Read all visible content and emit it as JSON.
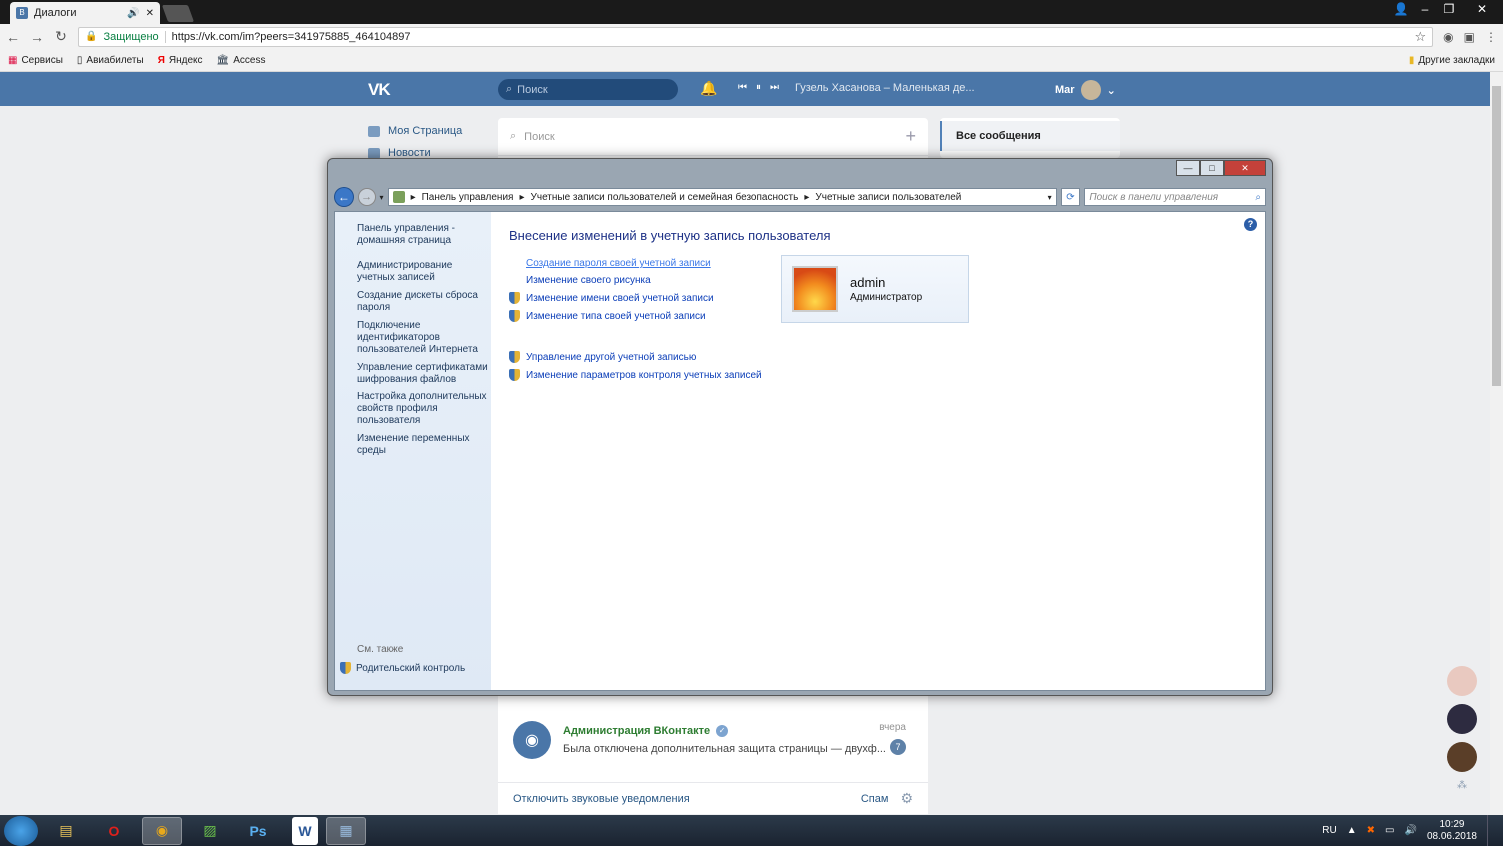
{
  "browser": {
    "tab_title": "Диалоги",
    "secure_label": "Защищено",
    "url": "https://vk.com/im?peers=341975885_464104897",
    "bookmarks": [
      "Сервисы",
      "Авиабилеты",
      "Яндекс",
      "Access"
    ],
    "other_bookmarks": "Другие закладки"
  },
  "vk": {
    "logo": "VK",
    "search_placeholder": "Поиск",
    "track": "Гузель Хасанова – Маленькая де...",
    "user_name": "Mar",
    "menu": [
      "Моя Страница",
      "Новости"
    ],
    "dialogs_search": "Поиск",
    "right_selected": "Все сообщения",
    "dialog": {
      "name": "Администрация ВКонтакте",
      "message": "Была отключена дополнительная защита страницы — двухф...",
      "time": "вчера",
      "unread": "7"
    },
    "footer_mute": "Отключить звуковые уведомления",
    "footer_spam": "Спам"
  },
  "cp": {
    "breadcrumb": [
      "Панель управления",
      "Учетные записи пользователей и семейная безопасность",
      "Учетные записи пользователей"
    ],
    "search_placeholder": "Поиск в панели управления",
    "side_links": [
      "Панель управления - домашняя страница",
      "Администрирование учетных записей",
      "Создание дискеты сброса пароля",
      "Подключение идентификаторов пользователей Интернета",
      "Управление сертификатами шифрования файлов",
      "Настройка дополнительных свойств профиля пользователя",
      "Изменение переменных среды"
    ],
    "see_also": "См. также",
    "parental": "Родительский контроль",
    "heading": "Внесение изменений в учетную запись пользователя",
    "tasks": [
      "Создание пароля своей учетной записи",
      "Изменение своего рисунка",
      "Изменение имени своей учетной записи",
      "Изменение типа своей учетной записи",
      "Управление другой учетной записью",
      "Изменение параметров контроля учетных записей"
    ],
    "user_name": "admin",
    "user_role": "Администратор"
  },
  "taskbar": {
    "lang": "RU",
    "time": "10:29",
    "date": "08.06.2018"
  }
}
